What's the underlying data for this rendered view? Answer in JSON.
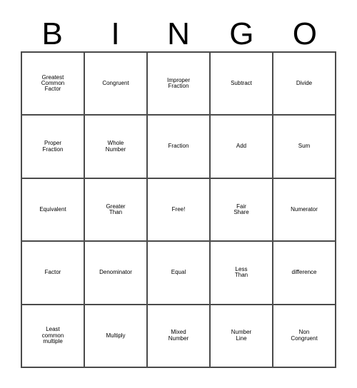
{
  "header": {
    "letters": [
      "B",
      "I",
      "N",
      "G",
      "O"
    ]
  },
  "grid": {
    "rows": 5,
    "columns": 5,
    "line_color": "#4a4a4a",
    "background": "#ffffff",
    "text_color": "#000000",
    "cells": [
      [
        {
          "label": "Greatest\nCommon\nFactor",
          "size": "m"
        },
        {
          "label": "Congruent",
          "size": "s"
        },
        {
          "label": "Improper\nFraction",
          "size": "m"
        },
        {
          "label": "Subtract",
          "size": "m"
        },
        {
          "label": "Divide",
          "size": "xl"
        }
      ],
      [
        {
          "label": "Proper\nFraction",
          "size": "l"
        },
        {
          "label": "Whole\nNumber",
          "size": "l"
        },
        {
          "label": "Fraction",
          "size": "m"
        },
        {
          "label": "Add",
          "size": "xxl"
        },
        {
          "label": "Sum",
          "size": "xxl"
        }
      ],
      [
        {
          "label": "Equivalent",
          "size": "s"
        },
        {
          "label": "Greater\nThan",
          "size": "l"
        },
        {
          "label": "Free!",
          "size": "xxl"
        },
        {
          "label": "Fair\nShare",
          "size": "xl"
        },
        {
          "label": "Numerator",
          "size": "xs"
        }
      ],
      [
        {
          "label": "Factor",
          "size": "xxl"
        },
        {
          "label": "Denominator",
          "size": "xs"
        },
        {
          "label": "Equal",
          "size": "xxl"
        },
        {
          "label": "Less\nThan",
          "size": "xl"
        },
        {
          "label": "difference",
          "size": "xs"
        }
      ],
      [
        {
          "label": "Least\ncommon\nmultiple",
          "size": "m"
        },
        {
          "label": "Multiply",
          "size": "l"
        },
        {
          "label": "Mixed\nNumber",
          "size": "l"
        },
        {
          "label": "Number\nLine",
          "size": "l"
        },
        {
          "label": "Non\nCongruent",
          "size": "s"
        }
      ]
    ]
  }
}
